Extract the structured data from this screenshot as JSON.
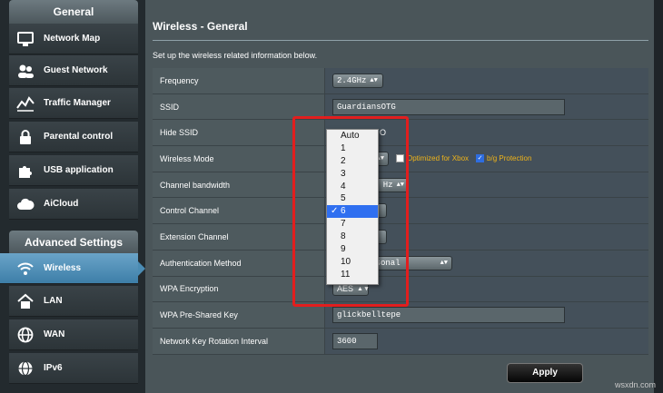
{
  "sidebar": {
    "general_heading": "General",
    "general_items": [
      {
        "label": "Network Map",
        "icon": "network-map-icon"
      },
      {
        "label": "Guest Network",
        "icon": "guest-network-icon"
      },
      {
        "label": "Traffic Manager",
        "icon": "traffic-manager-icon"
      },
      {
        "label": "Parental control",
        "icon": "parental-control-icon"
      },
      {
        "label": "USB application",
        "icon": "usb-application-icon"
      },
      {
        "label": "AiCloud",
        "icon": "aicloud-icon"
      }
    ],
    "advanced_heading": "Advanced Settings",
    "advanced_items": [
      {
        "label": "Wireless",
        "icon": "wireless-icon",
        "active": true
      },
      {
        "label": "LAN",
        "icon": "lan-icon"
      },
      {
        "label": "WAN",
        "icon": "wan-icon"
      },
      {
        "label": "IPv6",
        "icon": "ipv6-icon"
      }
    ]
  },
  "main": {
    "title": "Wireless - General",
    "description": "Set up the wireless related information below.",
    "rows": {
      "frequency": {
        "label": "Frequency",
        "value": "2.4GHz"
      },
      "ssid": {
        "label": "SSID",
        "value": "GuardiansOTG"
      },
      "hide_ssid": {
        "label": "Hide SSID",
        "value": "O"
      },
      "wireless_mode": {
        "label": "Wireless Mode",
        "opt_xbox": "Optimized for Xbox",
        "opt_bg": "b/g Protection"
      },
      "channel_bandwidth": {
        "label": "Channel bandwidth",
        "value": "Hz"
      },
      "control_channel": {
        "label": "Control Channel"
      },
      "extension_channel": {
        "label": "Extension Channel"
      },
      "auth_method": {
        "label": "Authentication Method",
        "value": "rsonal"
      },
      "wpa_encryption": {
        "label": "WPA Encryption",
        "value": "AES"
      },
      "wpa_key": {
        "label": "WPA Pre-Shared Key",
        "value": "glickbelltepe"
      },
      "rotation_interval": {
        "label": "Network Key Rotation Interval",
        "value": "3600"
      }
    },
    "apply_label": "Apply"
  },
  "channel_dropdown": {
    "options": [
      "Auto",
      "1",
      "2",
      "3",
      "4",
      "5",
      "6",
      "7",
      "8",
      "9",
      "10",
      "11"
    ],
    "selected": "6",
    "check_mark": "✓"
  },
  "watermark": "wsxdn.com",
  "colors": {
    "highlight": "#e21e1e",
    "selected_option": "#2f6ff0",
    "accent_label": "#f0b419"
  }
}
